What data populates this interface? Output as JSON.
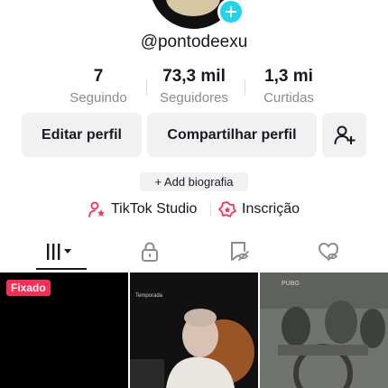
{
  "profile": {
    "username": "@pontodeexu"
  },
  "stats": [
    {
      "value": "7",
      "label": "Seguindo"
    },
    {
      "value": "73,3 mil",
      "label": "Seguidores"
    },
    {
      "value": "1,3 mi",
      "label": "Curtidas"
    }
  ],
  "actions": {
    "edit_profile": "Editar perfil",
    "share_profile": "Compartilhar perfil",
    "add_friend_icon": "person-plus-icon"
  },
  "bio": {
    "add_label": "+ Add biografia"
  },
  "links": {
    "studio": "TikTok Studio",
    "subscription": "Inscrição"
  },
  "tabs": [
    {
      "icon": "grid-bars-icon",
      "active": true
    },
    {
      "icon": "lock-icon",
      "active": false
    },
    {
      "icon": "bookmark-icon",
      "active": false
    },
    {
      "icon": "heart-eye-icon",
      "active": false
    }
  ],
  "grid": {
    "pinned_label": "Fixado",
    "cell2_overlay": "Temporada",
    "cell3_overlay": "PUBG"
  },
  "colors": {
    "accent": "#fe2c55",
    "badge": "#20d5ec",
    "text": "#161823",
    "muted": "#8a8b91",
    "button_bg": "#f1f1f2"
  }
}
